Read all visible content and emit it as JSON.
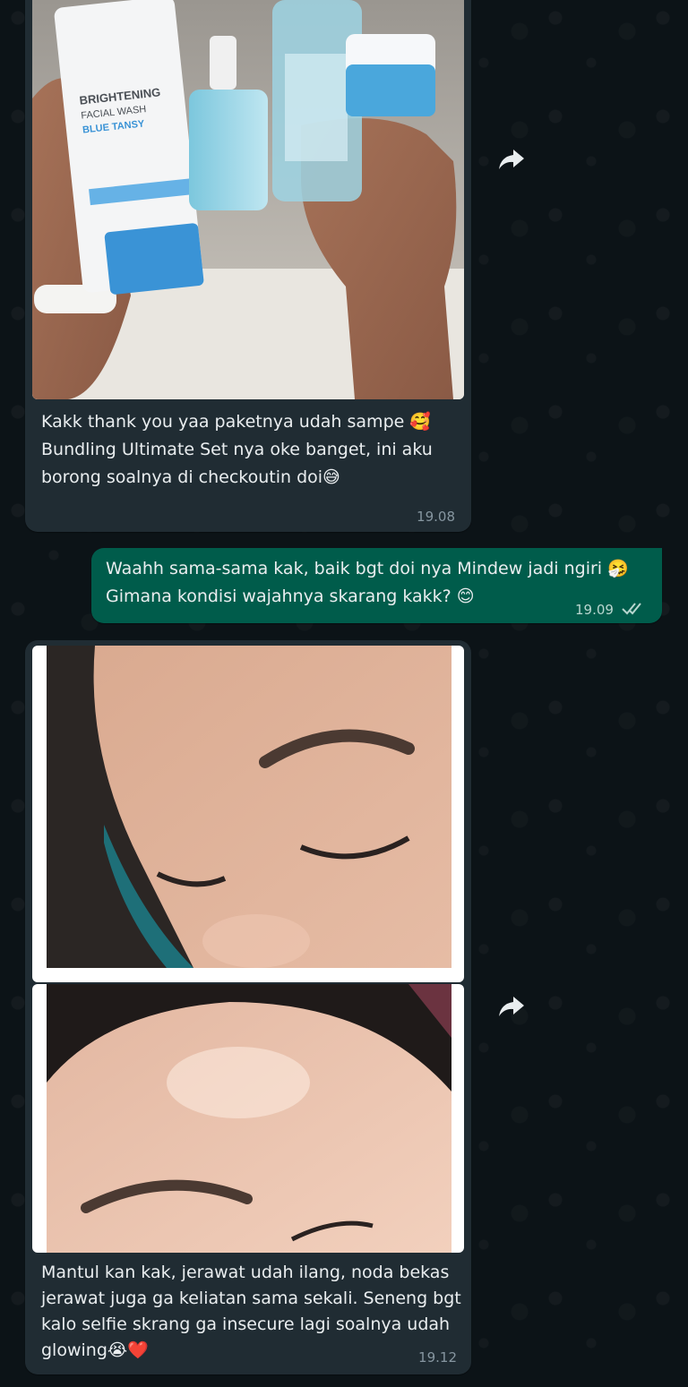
{
  "messages": [
    {
      "direction": "incoming",
      "image": {
        "icon": "photo-skincare-products",
        "product_text": [
          "BRIGHTENING",
          "FACIAL WASH",
          "BLUE TANSY"
        ]
      },
      "text": "Kakk thank you yaa paketnya udah sampe 🥰 Bundling Ultimate Set nya oke banget, ini aku borong soalnya di checkoutin doi😅",
      "time": "19.08"
    },
    {
      "direction": "outgoing",
      "text": "Waahh sama-sama kak, baik bgt doi nya Mindew jadi ngiri 🤧 Gimana kondisi wajahnya skarang kakk? 😊",
      "time": "19.09",
      "status_icon": "double-check-icon"
    },
    {
      "direction": "incoming",
      "images": [
        {
          "icon": "photo-face-eye"
        },
        {
          "icon": "photo-face-forehead"
        }
      ],
      "text": "Mantul kan kak, jerawat udah ilang, noda bekas jerawat juga ga keliatan sama sekali. Seneng bgt kalo selfie skrang ga insecure lagi soalnya udah glowing😭❤️",
      "time": "19.12"
    }
  ],
  "colors": {
    "background": "#0b141a",
    "incoming_bubble": "#202c33",
    "outgoing_bubble": "#005c4b",
    "text": "#e9edef",
    "timestamp": "#8696a0"
  },
  "icons": {
    "forward": "forward-arrow-icon",
    "read_receipt": "double-check-icon"
  }
}
